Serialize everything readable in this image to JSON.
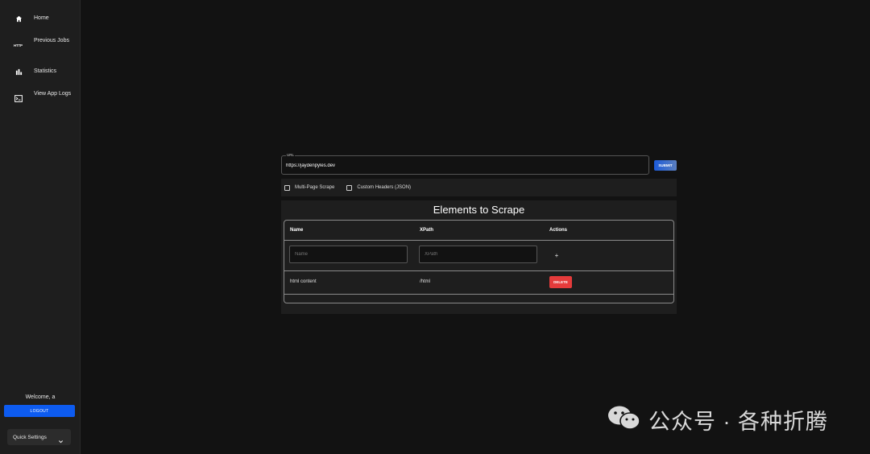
{
  "sidebar": {
    "items": [
      {
        "label": "Home",
        "icon": "home-icon"
      },
      {
        "label": "Previous Jobs",
        "icon": "http-icon"
      },
      {
        "label": "Statistics",
        "icon": "bar-chart-icon"
      },
      {
        "label": "View App Logs",
        "icon": "terminal-icon"
      }
    ],
    "welcome": "Welcome, a",
    "logout_label": "LOGOUT",
    "quick_settings_label": "Quick Settings"
  },
  "form": {
    "url_label": "URL",
    "url_value": "https://jaydenpyles.dev",
    "submit_label": "SUBMIT",
    "options": [
      "Multi-Page Scrape",
      "Custom Headers (JSON)"
    ]
  },
  "elements": {
    "title": "Elements to Scrape",
    "columns": [
      "Name",
      "XPath",
      "Actions"
    ],
    "name_placeholder": "Name",
    "xpath_placeholder": "XPath",
    "add_symbol": "+",
    "rows": [
      {
        "name": "html content",
        "xpath": "/html",
        "action_label": "DELETE"
      }
    ]
  },
  "watermark": {
    "text": "公众号 · 各种折腾"
  },
  "colors": {
    "background": "#121212",
    "sidebar": "#1e1e1e",
    "primary": "#0d5bf0",
    "danger": "#e53b3b"
  }
}
